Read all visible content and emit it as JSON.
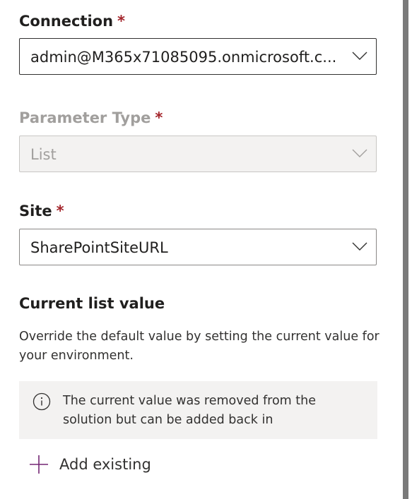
{
  "connection": {
    "label": "Connection",
    "required_mark": "*",
    "value": "admin@M365x71085095.onmicrosoft.c..."
  },
  "parameter_type": {
    "label": "Parameter Type",
    "required_mark": "*",
    "value": "List"
  },
  "site": {
    "label": "Site",
    "required_mark": "*",
    "value": "SharePointSiteURL"
  },
  "current_list": {
    "title": "Current list value",
    "description": "Override the default value by setting the current value for your environment."
  },
  "info": {
    "icon": "info-icon",
    "message": "The current value was removed from the solution but can be added back in"
  },
  "add_existing": {
    "icon": "plus-icon",
    "label": "Add existing",
    "accent_color": "#742774"
  },
  "colors": {
    "required": "#a4262c",
    "disabled_text": "#a19f9d",
    "disabled_bg": "#f3f2f1"
  }
}
